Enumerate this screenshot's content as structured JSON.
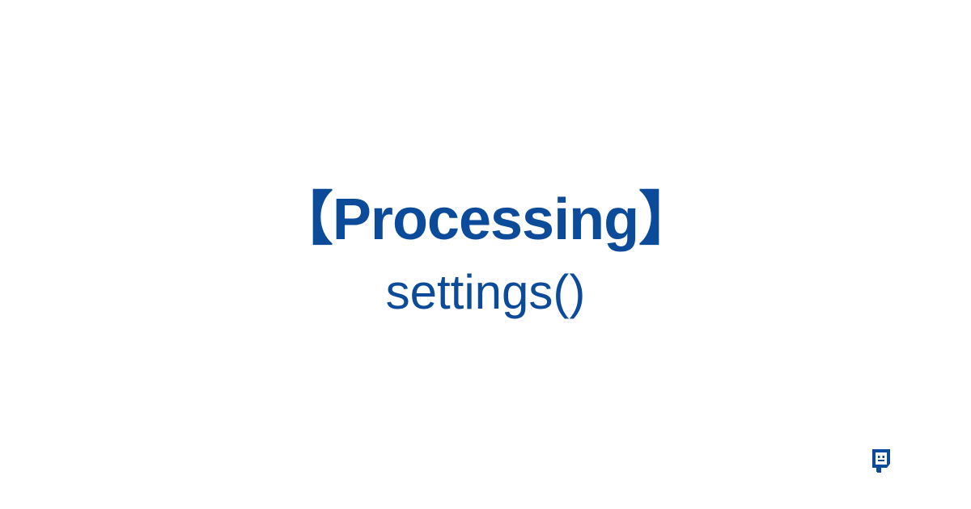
{
  "title": {
    "line1": "【Processing】",
    "line2": "settings()"
  },
  "colors": {
    "text": "#0b4b99",
    "background": "#ffffff"
  }
}
